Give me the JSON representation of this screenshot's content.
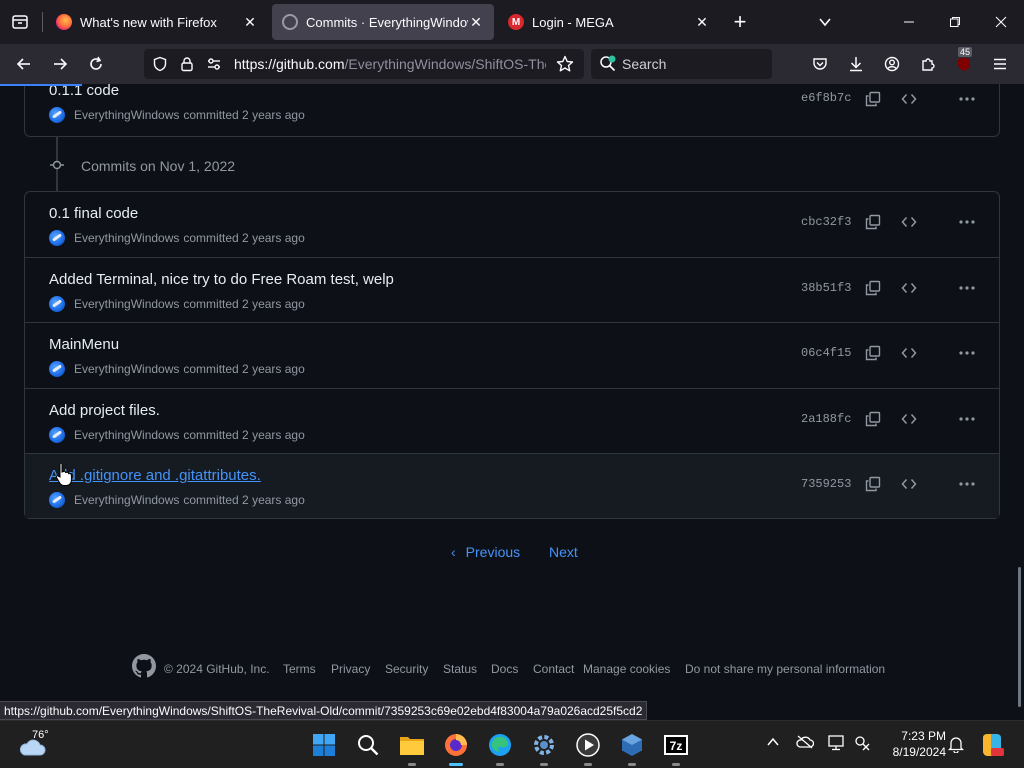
{
  "browser": {
    "tabs": [
      {
        "title": "What's new with Firefox",
        "close": "✕"
      },
      {
        "title": "Commits · EverythingWindows",
        "close": "✕"
      },
      {
        "title": "Login - MEGA",
        "close": "✕"
      }
    ],
    "new_tab": "+",
    "url_host": "https://github.com",
    "url_path": "/EverythingWindows/ShiftOS-TheRevival-Old/commits",
    "search_placeholder": "Search",
    "extension_badge": "45",
    "status_url": "https://github.com/EverythingWindows/ShiftOS-TheRevival-Old/commit/7359253c69e02ebd4f83004a79a026acd25f5cd2"
  },
  "commits_top": [
    {
      "message": "0.1.1 code",
      "author": "EverythingWindows",
      "when": "committed 2 years ago",
      "sha": "e6f8b7c"
    }
  ],
  "group": {
    "heading": "Commits on Nov 1, 2022"
  },
  "commits": [
    {
      "message": "0.1 final code",
      "author": "EverythingWindows",
      "when": "committed 2 years ago",
      "sha": "cbc32f3"
    },
    {
      "message": "Added Terminal, nice try to do Free Roam test, welp",
      "author": "EverythingWindows",
      "when": "committed 2 years ago",
      "sha": "38b51f3"
    },
    {
      "message": "MainMenu",
      "author": "EverythingWindows",
      "when": "committed 2 years ago",
      "sha": "06c4f15"
    },
    {
      "message": "Add project files.",
      "author": "EverythingWindows",
      "when": "committed 2 years ago",
      "sha": "2a188fc"
    },
    {
      "message": "Add .gitignore and .gitattributes.",
      "author": "EverythingWindows",
      "when": "committed 2 years ago",
      "sha": "7359253"
    }
  ],
  "pagination": {
    "previous": "Previous",
    "next": "Next"
  },
  "footer": {
    "copyright": "© 2024 GitHub, Inc.",
    "links": [
      "Terms",
      "Privacy",
      "Security",
      "Status",
      "Docs",
      "Contact",
      "Manage cookies",
      "Do not share my personal information"
    ]
  },
  "taskbar": {
    "weather_temp": "76°",
    "time": "7:23 PM",
    "date": "8/19/2024"
  }
}
